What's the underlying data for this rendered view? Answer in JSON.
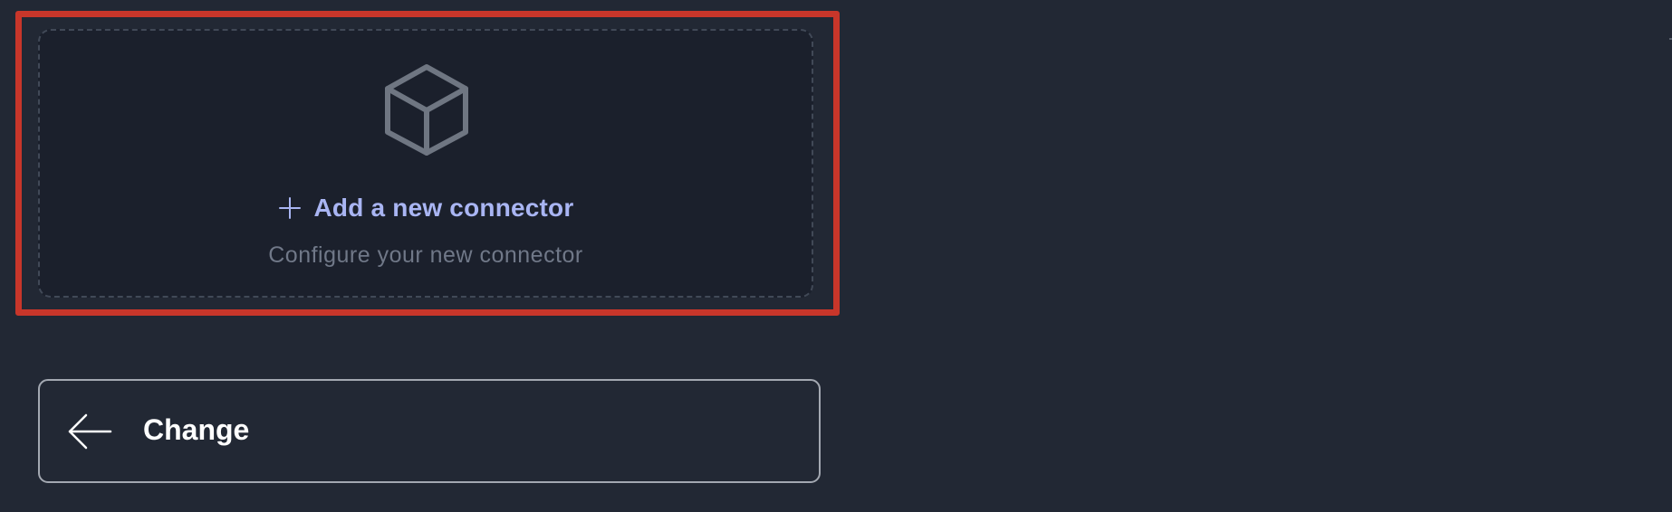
{
  "connector_card": {
    "icon": "cube-icon",
    "add_icon": "plus-icon",
    "add_label": "Add a new connector",
    "description": "Configure your new connector"
  },
  "change_button": {
    "icon": "arrow-left-icon",
    "label": "Change"
  },
  "colors": {
    "background": "#222834",
    "card_background": "#1b202c",
    "highlight_border": "#c8362a",
    "accent": "#a9b5f3",
    "muted_text": "#707888"
  }
}
